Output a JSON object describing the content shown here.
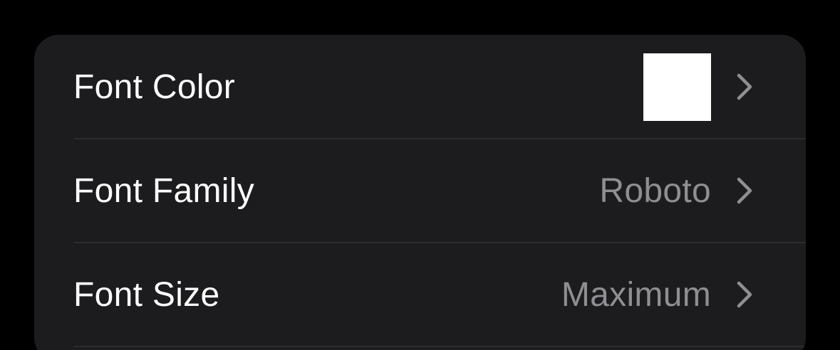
{
  "settings": {
    "rows": [
      {
        "label": "Font Color",
        "swatch_color": "#ffffff",
        "chevron_icon": "chevron-right-icon"
      },
      {
        "label": "Font Family",
        "value": "Roboto",
        "chevron_icon": "chevron-right-icon"
      },
      {
        "label": "Font Size",
        "value": "Maximum",
        "chevron_icon": "chevron-right-icon"
      }
    ]
  },
  "colors": {
    "background": "#000000",
    "panel": "#1c1c1e",
    "label": "#ffffff",
    "secondary": "#8e8e93",
    "chevron": "#8e8e93",
    "divider": "#2c2c2e"
  }
}
